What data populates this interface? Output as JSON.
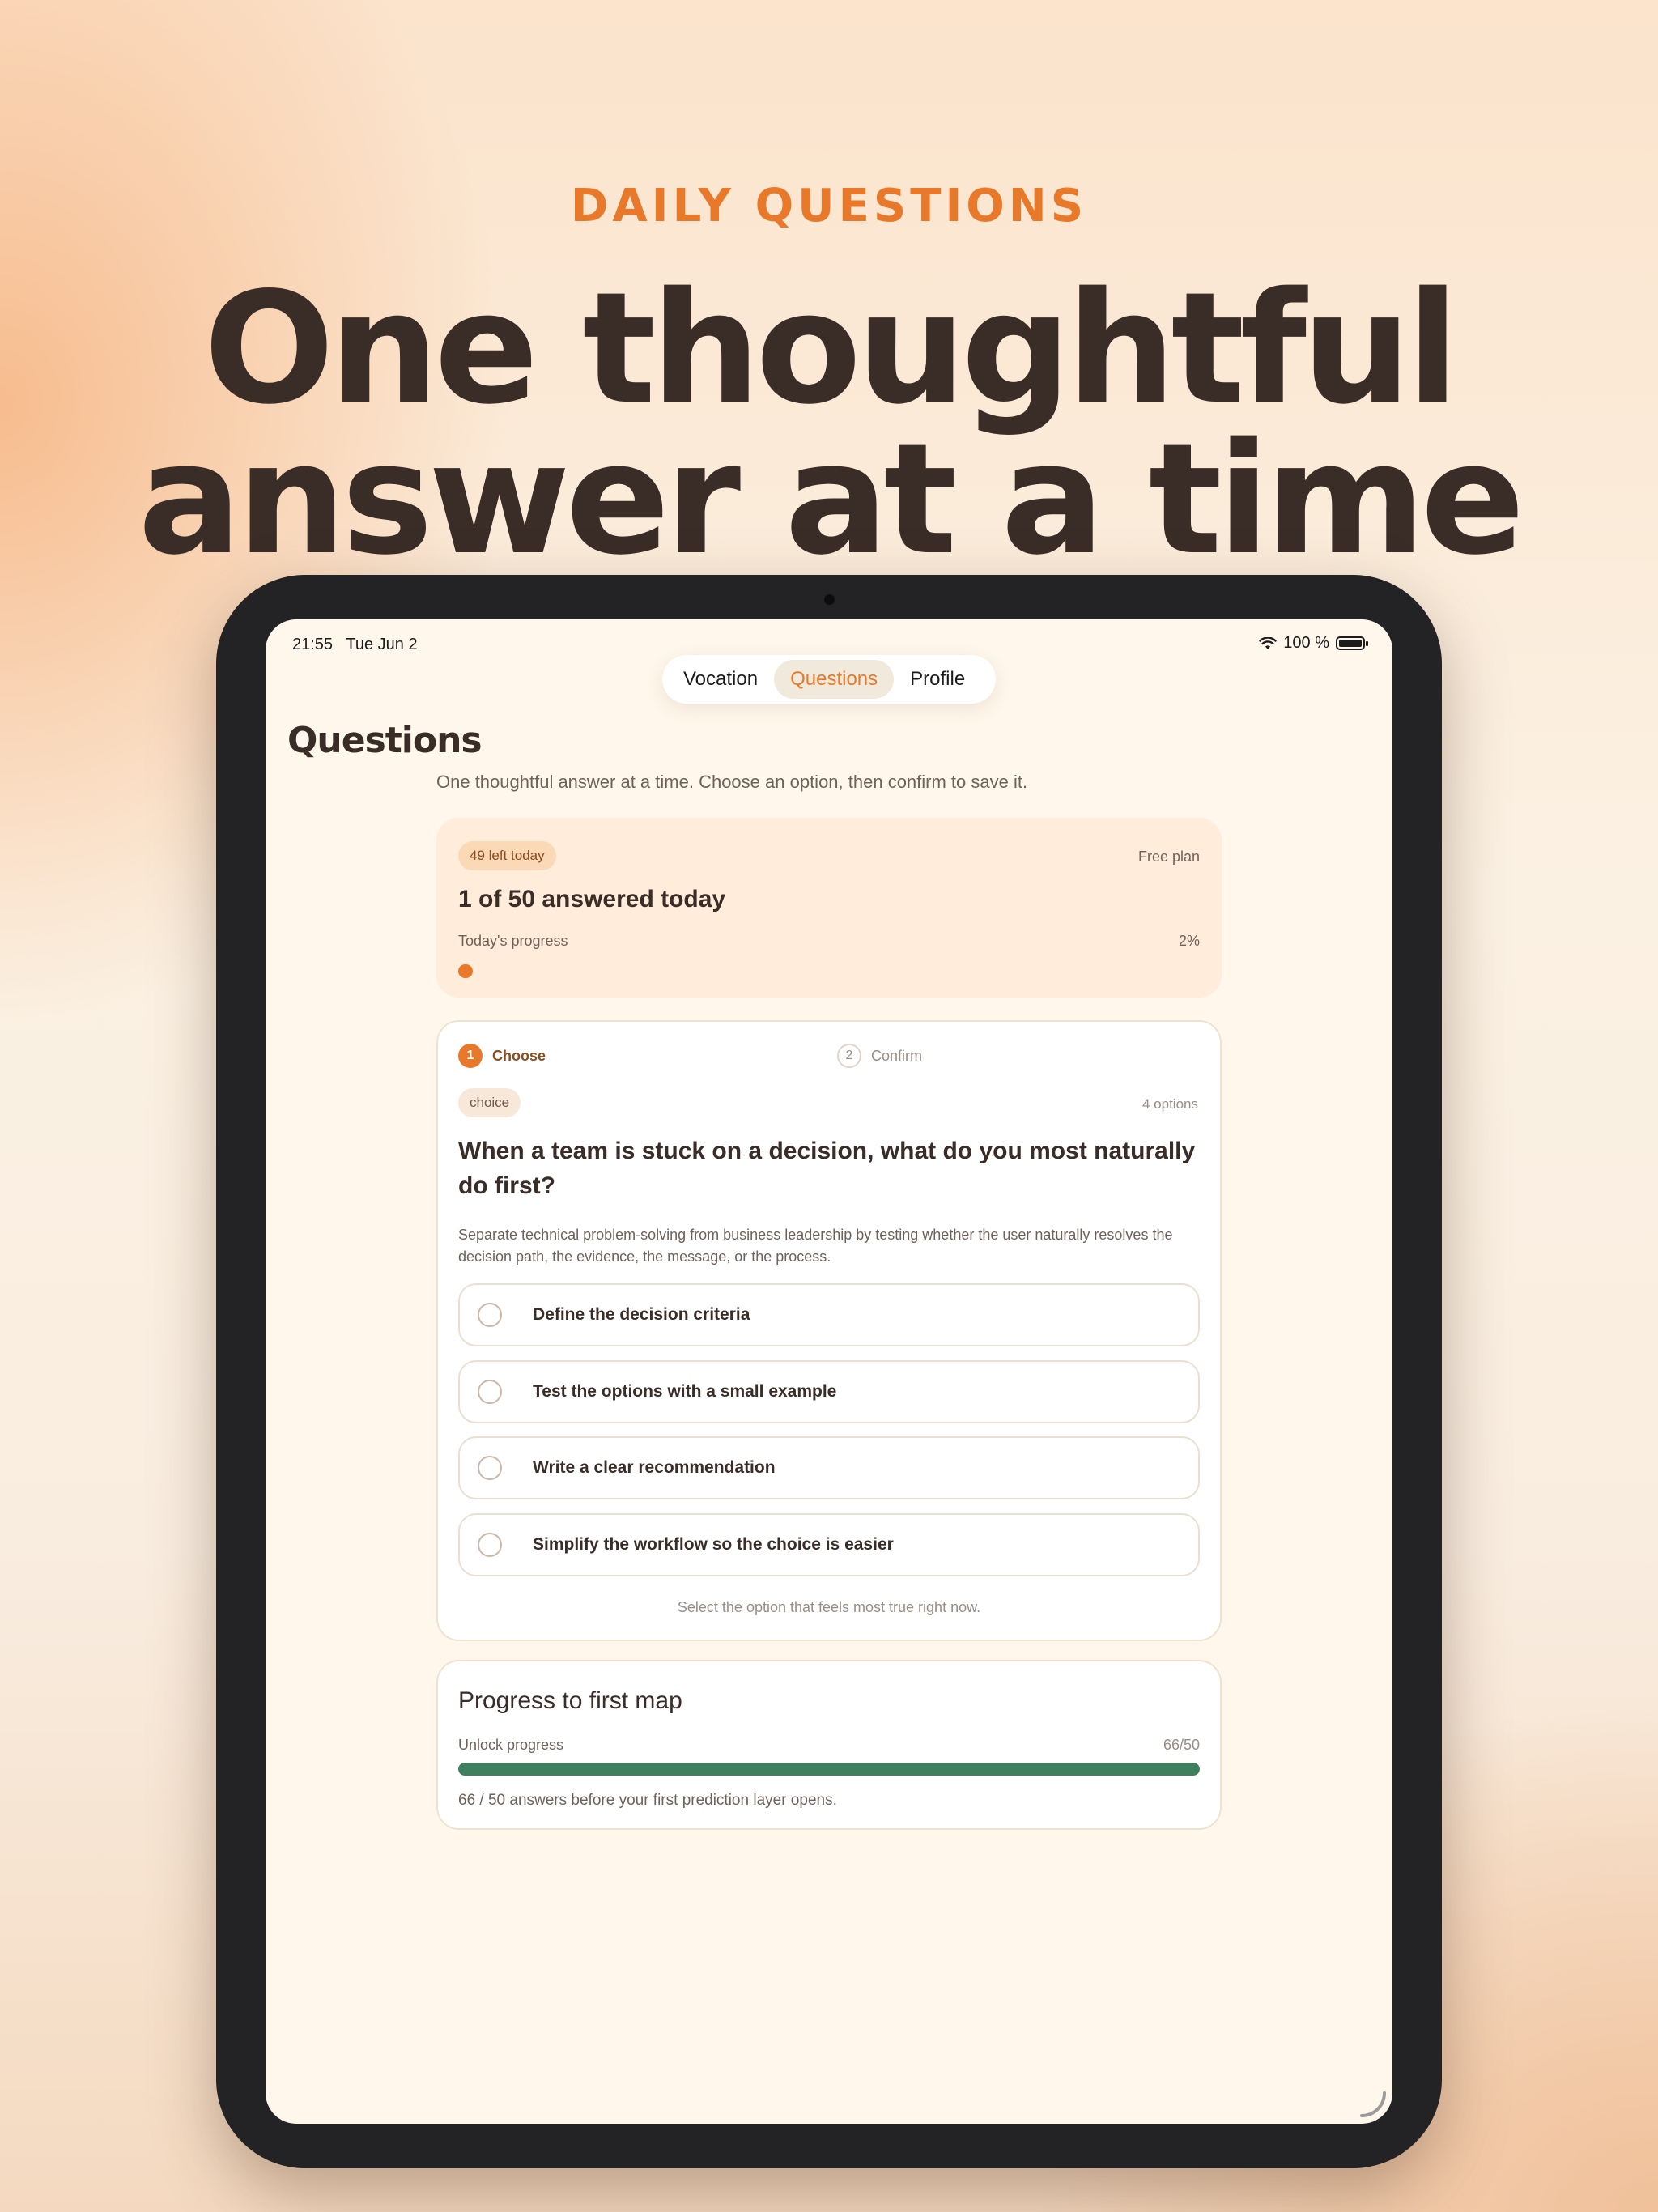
{
  "hero": {
    "eyebrow": "DAILY QUESTIONS",
    "title_line1": "One thoughtful",
    "title_line2": "answer at a time"
  },
  "status_bar": {
    "time": "21:55",
    "date": "Tue Jun 2",
    "battery": "100 %"
  },
  "tabs": [
    {
      "label": "Vocation",
      "active": false
    },
    {
      "label": "Questions",
      "active": true
    },
    {
      "label": "Profile",
      "active": false
    }
  ],
  "page": {
    "title": "Questions",
    "subtitle": "One thoughtful answer at a time. Choose an option, then confirm to save it."
  },
  "plan": {
    "remaining_badge": "49 left today",
    "plan_name": "Free plan",
    "answered": "1 of 50 answered today",
    "progress_label": "Today's progress",
    "progress_pct_text": "2%",
    "progress_fraction": 0.02
  },
  "question": {
    "steps": [
      {
        "num": "1",
        "label": "Choose"
      },
      {
        "num": "2",
        "label": "Confirm"
      }
    ],
    "type": "choice",
    "options_count": "4 options",
    "text": "When a team is stuck on a decision, what do you most naturally do first?",
    "description": "Separate technical problem-solving from business leadership by testing whether the user naturally resolves the decision path, the evidence, the message, or the process.",
    "options": [
      "Define the decision criteria",
      "Test the options with a small example",
      "Write a clear recommendation",
      "Simplify the workflow so the choice is easier"
    ],
    "hint": "Select the option that feels most true right now."
  },
  "map_progress": {
    "title": "Progress to first map",
    "label": "Unlock progress",
    "value_text": "66/50",
    "progress_fraction": 1.0,
    "note": "66 / 50 answers before your first prediction layer opens."
  },
  "colors": {
    "accent": "#e8792b",
    "text": "#3a2c27",
    "success": "#3f7f5e"
  }
}
